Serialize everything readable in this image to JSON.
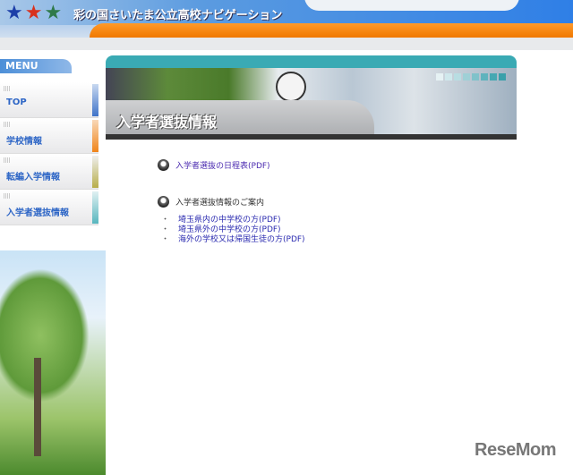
{
  "header": {
    "site_title": "彩の国さいたま公立高校ナビゲーション"
  },
  "sidebar": {
    "menu_title": "MENU",
    "items": [
      {
        "label": "TOP",
        "color": "#3f73c8"
      },
      {
        "label": "学校情報",
        "color": "#f0841a"
      },
      {
        "label": "転編入学情報",
        "color": "#b8ae4a"
      },
      {
        "label": "入学者選抜情報",
        "color": "#57b6be"
      }
    ]
  },
  "banner": {
    "title": "入学者選抜情報"
  },
  "content": {
    "schedule_link": "入学者選抜の日程表(PDF)",
    "guide_heading": "入学者選抜情報のご案内",
    "guide_links": [
      "埼玉県内の中学校の方(PDF)",
      "埼玉県外の中学校の方(PDF)",
      "海外の学校又は帰国生徒の方(PDF)"
    ],
    "bullet": "・"
  },
  "watermark": "ReseMom"
}
